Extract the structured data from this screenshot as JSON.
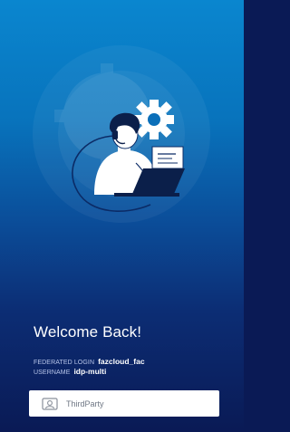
{
  "header": {
    "title": "Welcome Back!"
  },
  "login": {
    "federated_label": "FEDERATED LOGIN",
    "federated_value": "fazcloud_fac",
    "username_label": "USERNAME",
    "username_value": "idp-multi"
  },
  "idp": {
    "label": "ThirdParty",
    "icon": "id-card-icon"
  },
  "illustration": {
    "subject": "support-agent-with-headset-at-laptop",
    "icons": [
      "gear-icon",
      "phone-cord",
      "laptop-icon",
      "document-icon"
    ]
  },
  "colors": {
    "background_top": "#0a86cf",
    "background_bottom": "#0a1a55",
    "button_bg": "#ffffff",
    "text_primary": "#ffffff",
    "text_muted": "#b9c6ea"
  }
}
